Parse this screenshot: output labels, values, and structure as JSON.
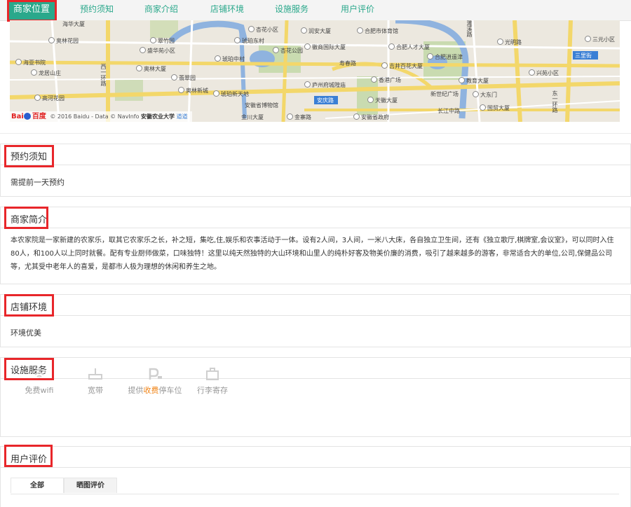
{
  "nav": {
    "tabs": [
      {
        "label": "商家位置",
        "active": true
      },
      {
        "label": "预约须知",
        "active": false
      },
      {
        "label": "商家介绍",
        "active": false
      },
      {
        "label": "店铺环境",
        "active": false
      },
      {
        "label": "设施服务",
        "active": false
      },
      {
        "label": "用户评价",
        "active": false
      }
    ]
  },
  "map": {
    "labels": [
      "奥林花园",
      "翠竹园",
      "盛华苑小区",
      "海亚书院",
      "龙居山庄",
      "西一环路",
      "奥林大厦",
      "翡翠园",
      "奥林新城",
      "高河花园",
      "琥珀东村",
      "琥珀中村",
      "琥珀新天地",
      "杏花公园",
      "杏花小区",
      "润安大厦",
      "徽商国际大厦",
      "合肥市体育馆",
      "合肥人才大厦",
      "吉井百花大厦",
      "合肥逍遥津",
      "安徽省博物馆",
      "庐州府城隍庙",
      "香港广场",
      "安庆路",
      "天徽大厦",
      "长江中路",
      "安徽省政府",
      "金川大厦",
      "金寨路",
      "新世纪广场",
      "光明路",
      "东一环路",
      "大东门",
      "教育大厦",
      "兴苑小区",
      "三元小区",
      "三里街",
      "濉溪路",
      "国贸大厦",
      "寿春路",
      "安徽农业大学",
      "海华大厦"
    ],
    "attribution": "© 2016 Baidu - Data © NavInfo",
    "baidu_logo": "Bai",
    "baidu_logo_suffix": "百度",
    "attribution_overlay": "安徽农业大学",
    "attribution_tail": "道道通"
  },
  "booking": {
    "title": "预约须知",
    "content": "需提前一天预约"
  },
  "intro": {
    "title": "商家简介",
    "content": "本农家院是一家新建的农家乐，取其它农家乐之长，补之短，集吃,住,娱乐和农事活动于一体。设有2人间，3人间，一米八大床，各自独立卫生间，还有《独立歌厅,棋牌室,会议室》，可以同时入住80人，和100人以上同时就餐。配有专业厨师做菜，口味独特！这里以纯天然独特的大山环境和山里人的纯朴好客及物美价廉的消费，吸引了越来越多的游客，非常适合大的单位,公司,保健品公司等，尤其受中老年人的喜爱，是都市人极为理想的休闲和养生之地。"
  },
  "environment": {
    "title": "店铺环境",
    "content": "环境优美"
  },
  "facilities": {
    "title": "设施服务",
    "items": [
      {
        "label": "免费wifi",
        "icon": "wifi-icon"
      },
      {
        "label": "宽带",
        "icon": "broadband-icon"
      },
      {
        "prefix": "提供",
        "highlight": "收费",
        "suffix": "停车位",
        "icon": "parking-icon"
      },
      {
        "label": "行李寄存",
        "icon": "luggage-icon"
      }
    ]
  },
  "reviews": {
    "title": "用户评价",
    "tabs": [
      {
        "label": "全部",
        "active": true
      },
      {
        "label": "晒图评价",
        "active": false
      }
    ]
  },
  "colors": {
    "accent": "#2aa88b",
    "highlight_box": "#e8262a",
    "charge_text": "#f08519"
  }
}
